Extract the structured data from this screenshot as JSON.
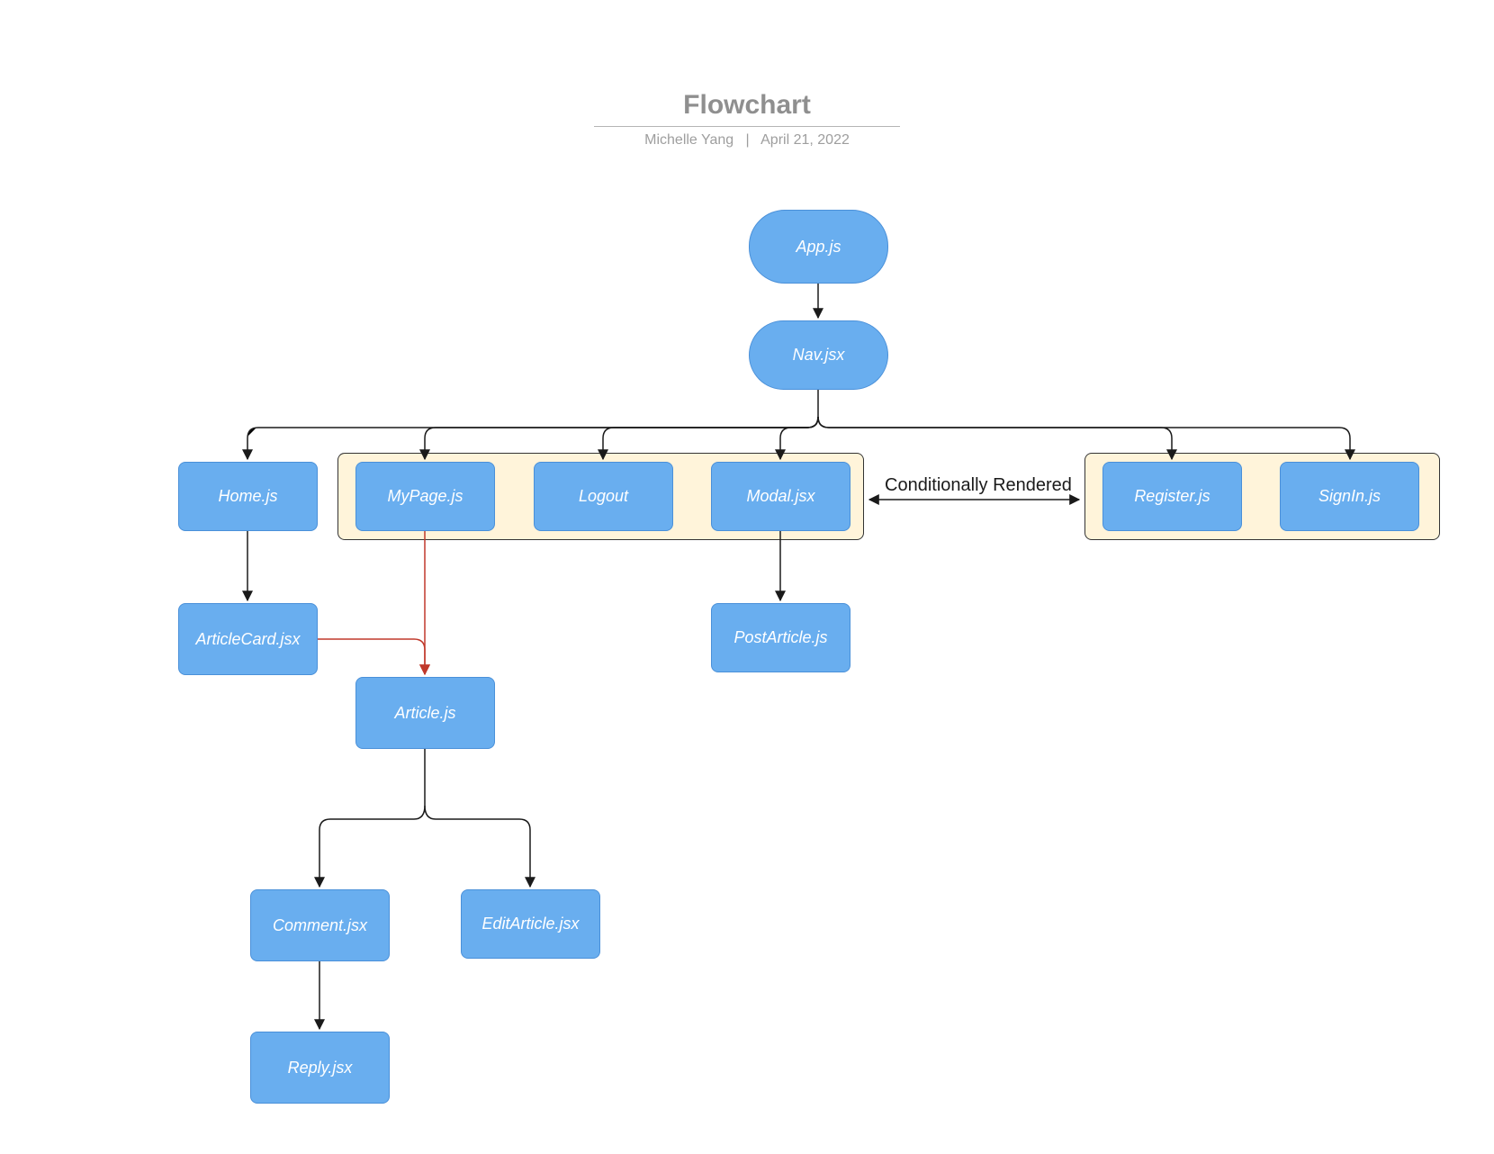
{
  "header": {
    "title": "Flowchart",
    "author": "Michelle Yang",
    "separator": "|",
    "date": "April 21, 2022"
  },
  "nodes": {
    "app": {
      "label": "App.js"
    },
    "nav": {
      "label": "Nav.jsx"
    },
    "home": {
      "label": "Home.js"
    },
    "mypage": {
      "label": "MyPage.js"
    },
    "logout": {
      "label": "Logout"
    },
    "modal": {
      "label": "Modal.jsx"
    },
    "register": {
      "label": "Register.js"
    },
    "signin": {
      "label": "SignIn.js"
    },
    "articlecard": {
      "label": "ArticleCard.jsx"
    },
    "postarticle": {
      "label": "PostArticle.js"
    },
    "article": {
      "label": "Article.js"
    },
    "comment": {
      "label": "Comment.jsx"
    },
    "editarticle": {
      "label": "EditArticle.jsx"
    },
    "reply": {
      "label": "Reply.jsx"
    }
  },
  "edge_label": "Conditionally Rendered",
  "chart_data": {
    "type": "flowchart",
    "title": "Flowchart",
    "author": "Michelle Yang",
    "date": "April 21, 2022",
    "nodes": [
      {
        "id": "app",
        "label": "App.js",
        "shape": "pill"
      },
      {
        "id": "nav",
        "label": "Nav.jsx",
        "shape": "pill"
      },
      {
        "id": "home",
        "label": "Home.js",
        "shape": "rect"
      },
      {
        "id": "mypage",
        "label": "MyPage.js",
        "shape": "rect",
        "group": "auth"
      },
      {
        "id": "logout",
        "label": "Logout",
        "shape": "rect",
        "group": "auth"
      },
      {
        "id": "modal",
        "label": "Modal.jsx",
        "shape": "rect",
        "group": "auth"
      },
      {
        "id": "register",
        "label": "Register.js",
        "shape": "rect",
        "group": "noauth"
      },
      {
        "id": "signin",
        "label": "SignIn.js",
        "shape": "rect",
        "group": "noauth"
      },
      {
        "id": "articlecard",
        "label": "ArticleCard.jsx",
        "shape": "rect"
      },
      {
        "id": "postarticle",
        "label": "PostArticle.js",
        "shape": "rect"
      },
      {
        "id": "article",
        "label": "Article.js",
        "shape": "rect"
      },
      {
        "id": "comment",
        "label": "Comment.jsx",
        "shape": "rect"
      },
      {
        "id": "editarticle",
        "label": "EditArticle.jsx",
        "shape": "rect"
      },
      {
        "id": "reply",
        "label": "Reply.jsx",
        "shape": "rect"
      }
    ],
    "groups": [
      {
        "id": "auth",
        "members": [
          "mypage",
          "logout",
          "modal"
        ]
      },
      {
        "id": "noauth",
        "members": [
          "register",
          "signin"
        ]
      }
    ],
    "edges": [
      {
        "from": "app",
        "to": "nav"
      },
      {
        "from": "nav",
        "to": "home"
      },
      {
        "from": "nav",
        "to": "mypage"
      },
      {
        "from": "nav",
        "to": "logout"
      },
      {
        "from": "nav",
        "to": "modal"
      },
      {
        "from": "nav",
        "to": "register"
      },
      {
        "from": "nav",
        "to": "signin"
      },
      {
        "from": "home",
        "to": "articlecard"
      },
      {
        "from": "modal",
        "to": "postarticle"
      },
      {
        "from": "mypage",
        "to": "article",
        "color": "red"
      },
      {
        "from": "articlecard",
        "to": "article",
        "color": "red"
      },
      {
        "from": "article",
        "to": "comment"
      },
      {
        "from": "article",
        "to": "editarticle"
      },
      {
        "from": "comment",
        "to": "reply"
      },
      {
        "from_group": "auth",
        "to_group": "noauth",
        "label": "Conditionally Rendered",
        "bidirectional": true
      }
    ]
  }
}
